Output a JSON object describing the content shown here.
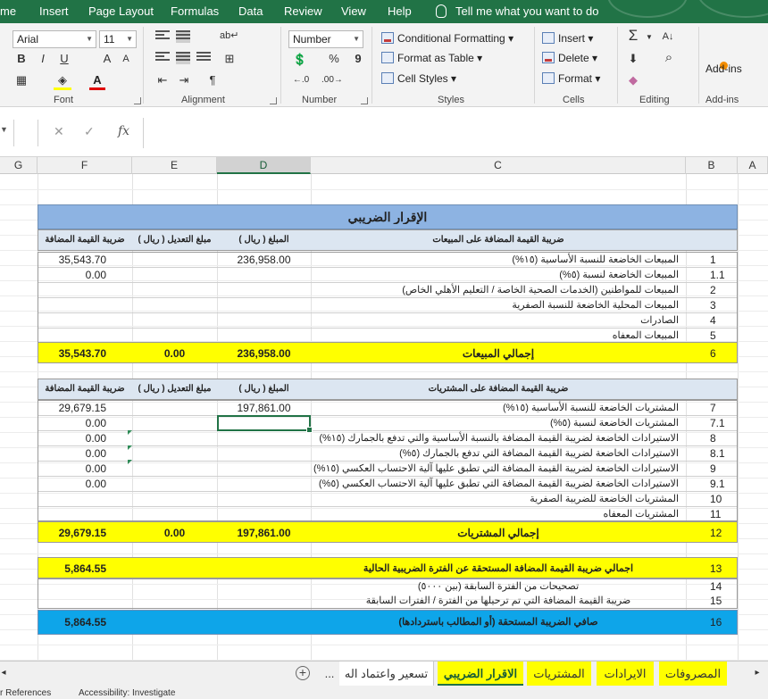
{
  "ribbon_tabs": [
    "me",
    "Insert",
    "Page Layout",
    "Formulas",
    "Data",
    "Review",
    "View",
    "Help"
  ],
  "tell_me": "Tell me what you want to do",
  "font": {
    "name": "Arial",
    "size": "11",
    "bold": "B",
    "italic": "I",
    "underline": "U",
    "grow": "A",
    "shrink": "A"
  },
  "number": {
    "format": "Number",
    "percent": "%",
    "comma": "9"
  },
  "styles": {
    "conditional": "Conditional Formatting",
    "table": "Format as Table",
    "cell": "Cell Styles"
  },
  "cells": {
    "insert": "Insert",
    "delete": "Delete",
    "format": "Format"
  },
  "editing": {
    "sum": "Σ",
    "sort": "A↓",
    "find": "⌕"
  },
  "addins": "Add-ins",
  "group_labels": {
    "font": "Font",
    "alignment": "Alignment",
    "number": "Number",
    "styles": "Styles",
    "cells": "Cells",
    "editing": "Editing",
    "addins": "Add-ins"
  },
  "formula_bar": {
    "cancel": "✕",
    "enter": "✓",
    "fx": "fx"
  },
  "columns": [
    "G",
    "F",
    "E",
    "D",
    "C",
    "B",
    "A"
  ],
  "report": {
    "title": "الإقرار الضريبي",
    "sales_header": {
      "tax": "ضريبة القيمة المضافة",
      "adjust": "مبلغ التعديل ( ريال )",
      "amount": "المبلغ ( ريال )",
      "desc": "ضريبة القيمة المضافة على المبيعات"
    },
    "sales_rows": [
      {
        "no": "1",
        "desc": "المبيعات الخاضعة للنسبة الأساسية (١٥%)",
        "amount": "236,958.00",
        "tax": "35,543.70"
      },
      {
        "no": "1.1",
        "desc": "المبيعات الخاضعة لنسبة (٥%)",
        "amount": "",
        "tax": "0.00"
      },
      {
        "no": "2",
        "desc": "المبيعات للمواطنين (الخدمات الصحية الخاصة / التعليم الأهلي الخاص)",
        "amount": "",
        "tax": ""
      },
      {
        "no": "3",
        "desc": "المبيعات المحلية الخاضعة للنسبة الصفرية",
        "amount": "",
        "tax": ""
      },
      {
        "no": "4",
        "desc": "الصادرات",
        "amount": "",
        "tax": ""
      },
      {
        "no": "5",
        "desc": "المبيعات المعفاه",
        "amount": "",
        "tax": ""
      }
    ],
    "sales_total": {
      "no": "6",
      "desc": "إجمالي المبيعات",
      "amount": "236,958.00",
      "adjust": "0.00",
      "tax": "35,543.70"
    },
    "purch_header": {
      "tax": "ضريبة القيمة المضافة",
      "adjust": "مبلغ التعديل ( ريال )",
      "amount": "المبلغ ( ريال )",
      "desc": "ضريبة القيمة المضافة على المشتريات"
    },
    "purch_rows": [
      {
        "no": "7",
        "desc": "المشتريات الخاضعة للنسبة الأساسية (١٥%)",
        "amount": "197,861.00",
        "tax": "29,679.15"
      },
      {
        "no": "7.1",
        "desc": "المشتريات الخاضعة لنسبة (٥%)",
        "amount": "",
        "tax": "0.00"
      },
      {
        "no": "8",
        "desc": "الاستيرادات الخاضعة لضريبة القيمة المضافة بالنسبة الأساسية والتي تدفع بالجمارك (١٥%)",
        "amount": "",
        "tax": "0.00"
      },
      {
        "no": "8.1",
        "desc": "الاستيرادات الخاضعة لضريبة القيمة المضافة التي تدفع بالجمارك (٥%)",
        "amount": "",
        "tax": "0.00"
      },
      {
        "no": "9",
        "desc": "الاستيرادات الخاضعة لضريبة القيمة المضافة التي تطبق عليها آلية الاحتساب العكسي (١٥%)",
        "amount": "",
        "tax": "0.00"
      },
      {
        "no": "9.1",
        "desc": "الاستيرادات الخاضعة لضريبة القيمة المضافة التي تطبق عليها آلية الاحتساب العكسي (٥%)",
        "amount": "",
        "tax": "0.00"
      },
      {
        "no": "10",
        "desc": "المشتريات الخاضعة للضريبة الصفرية",
        "amount": "",
        "tax": ""
      },
      {
        "no": "11",
        "desc": "المشتريات المعفاه",
        "amount": "",
        "tax": ""
      }
    ],
    "purch_total": {
      "no": "12",
      "desc": "إجمالي المشتريات",
      "amount": "197,861.00",
      "adjust": "0.00",
      "tax": "29,679.15"
    },
    "due": {
      "no": "13",
      "desc": "اجمالي ضريبة القيمة المضافة المستحقة عن الفترة الضريبية الحالية",
      "tax": "5,864.55"
    },
    "corrections": {
      "no": "14",
      "desc": "تصحيحات من الفترة السابقة (بين ٥٠٠٠)"
    },
    "carried": {
      "no": "15",
      "desc": "ضريبة القيمة المضافة التي تم ترحيلها من الفترة / الفترات السابقة"
    },
    "net": {
      "no": "16",
      "desc": "صافي الضريبة المستحقة (أو المطالب باستردادها)",
      "tax": "5,864.55"
    }
  },
  "sheet_tabs": [
    {
      "label": "المصروفات",
      "style": "yel"
    },
    {
      "label": "الايرادات",
      "style": "yel"
    },
    {
      "label": "المشتريات",
      "style": "yel"
    },
    {
      "label": "الاقرار الضريبي",
      "style": "active"
    },
    {
      "label": "تسعير واعتماد اله",
      "style": "plain"
    }
  ],
  "sheet_more": "...",
  "sheet_add": "+",
  "status": {
    "refs": "r References",
    "access": "Accessibility: Investigate"
  },
  "colors": {
    "header_blue": "#dce6f1",
    "title_blue": "#8db3e2",
    "yellow": "#ffff00",
    "net_blue": "#0ea5e9",
    "excel_green": "#217346"
  }
}
